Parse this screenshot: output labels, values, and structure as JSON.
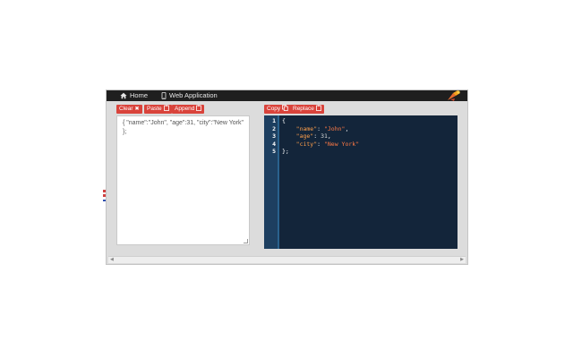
{
  "nav": {
    "home_label": "Home",
    "web_app_label": "Web Application"
  },
  "left_toolbar": {
    "clear_label": "Clear",
    "paste_label": "Paste",
    "append_label": "Append"
  },
  "right_toolbar": {
    "copy_label": "Copy",
    "replace_label": "Replace"
  },
  "input": {
    "value": "{ \"name\":\"John\", \"age\":31, \"city\":\"New York\" };"
  },
  "editor": {
    "line_numbers": [
      "1",
      "2",
      "3",
      "4",
      "5"
    ],
    "lines": [
      [
        {
          "t": "{",
          "c": "punct"
        }
      ],
      [
        {
          "t": "    ",
          "c": "punct"
        },
        {
          "t": "\"name\"",
          "c": "key"
        },
        {
          "t": ": ",
          "c": "punct"
        },
        {
          "t": "\"John\"",
          "c": "str"
        },
        {
          "t": ",",
          "c": "punct"
        }
      ],
      [
        {
          "t": "    ",
          "c": "punct"
        },
        {
          "t": "\"age\"",
          "c": "key"
        },
        {
          "t": ": ",
          "c": "punct"
        },
        {
          "t": "31",
          "c": "num"
        },
        {
          "t": ",",
          "c": "punct"
        }
      ],
      [
        {
          "t": "    ",
          "c": "punct"
        },
        {
          "t": "\"city\"",
          "c": "key"
        },
        {
          "t": ": ",
          "c": "punct"
        },
        {
          "t": "\"New York\"",
          "c": "str"
        }
      ],
      [
        {
          "t": "};",
          "c": "punct"
        }
      ]
    ]
  },
  "colors": {
    "button_red": "#d9433b",
    "editor_bg": "#13253a",
    "gutter_bg": "#1d3f60",
    "navbar_bg": "#1f1f1f"
  },
  "icons": {
    "home": "home-icon",
    "web_app": "mobile-icon",
    "clear": "close-icon",
    "paste": "clipboard-icon",
    "append": "clipboard-icon",
    "copy": "copy-icon",
    "replace": "clipboard-icon",
    "logo": "app-logo-icon"
  }
}
